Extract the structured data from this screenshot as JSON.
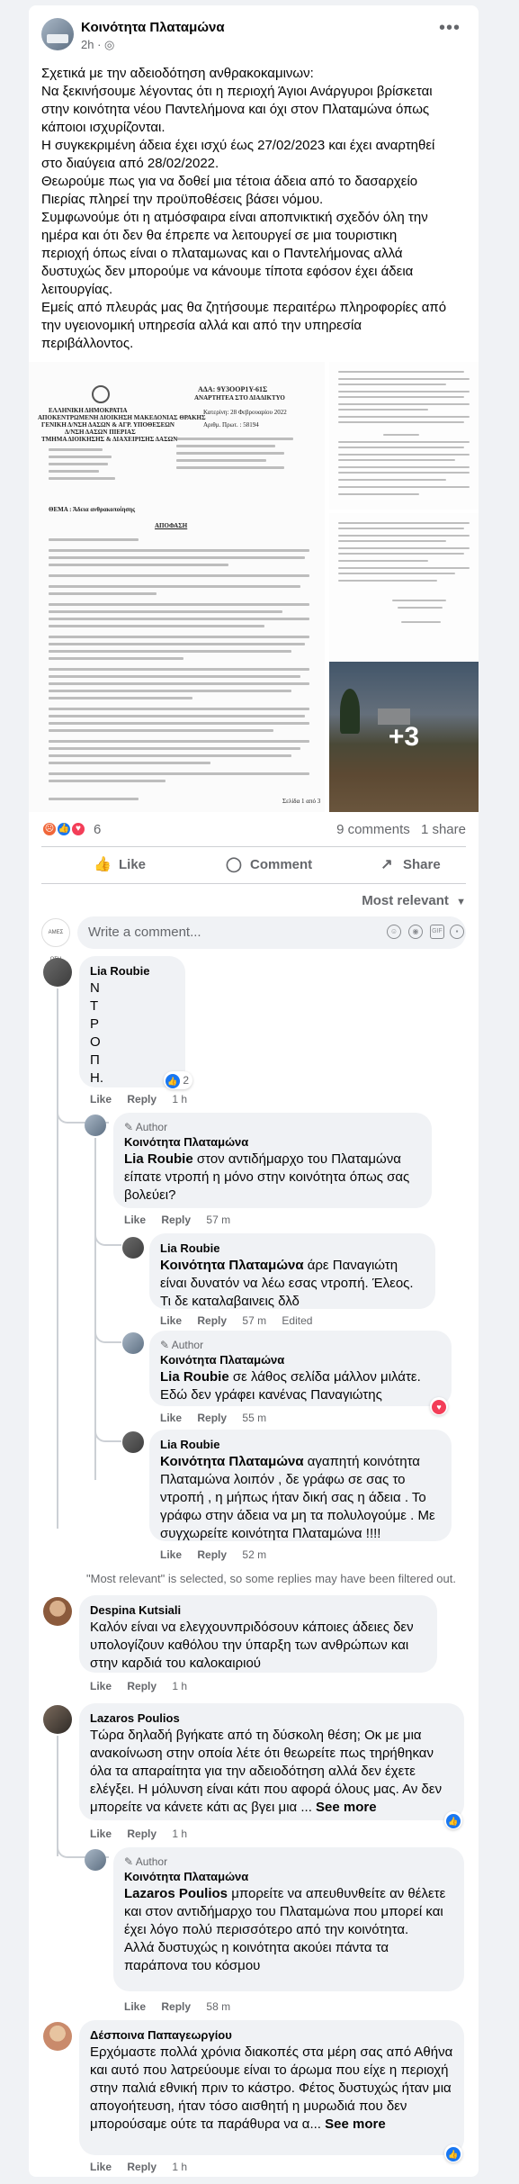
{
  "post": {
    "page_name": "Κοινότητα Πλαταμώνα",
    "time": "2h",
    "privacy_icon": "globe-icon",
    "text": [
      "Σχετικά με την αδειοδότηση ανθρακοκαμινων:",
      "Να ξεκινήσουμε λέγοντας ότι η περιοχή Άγιοι Ανάργυροι βρίσκεται",
      "στην κοινότητα νέου Παντελήμονα και όχι στον Πλαταμώνα όπως",
      "κάποιοι ισχυρίζονται.",
      "Η συγκεκριμένη άδεια έχει ισχύ έως 27/02/2023 και έχει αναρτηθεί",
      "στο διαύγεια από 28/02/2022.",
      "Θεωρούμε πως για να δοθεί μια τέτοια άδεια από το δασαρχείο",
      "Πιερίας πληρεί την προϋποθέσεις βάσει νόμου.",
      "Συμφωνούμε ότι η ατμόσφαιρα είναι αποπνικτική σχεδόν όλη την",
      "ημέρα και ότι δεν θα έπρεπε να λειτουργεί σε μια τουριστικη",
      "περιοχή όπως είναι ο πλαταμωνας και ο Παντελήμονας αλλά",
      "δυστυχώς δεν μπορούμε να κάνουμε τίποτα εφόσον έχει άδεια",
      "λειτουργίας.",
      "Εμείς από πλευράς μας θα ζητήσουμε περαιτέρω πληροφορίες από",
      "την υγειονομική υπηρεσία αλλά και από την υπηρεσία",
      "περιβάλλοντος."
    ],
    "more_count": "+3",
    "reaction_count": "6",
    "comments_count": "9 comments",
    "shares_count": "1 share"
  },
  "document": {
    "header_lines": [
      "ΕΛΛΗΝΙΚΗ ΔΗΜΟΚΡΑΤΙΑ",
      "ΑΠΟΚΕΝΤΡΩΜΕΝΗ ΔΙΟΙΚΗΣΗ ΜΑΚΕΔΟΝΙΑΣ ΘΡΑΚΗΣ",
      "ΓΕΝΙΚΗ Δ/ΝΣΗ ΔΑΣΩΝ & ΑΓΡ. ΥΠΟΘΕΣΕΩΝ",
      "Δ/ΝΣΗ ΔΑΣΩΝ ΠΙΕΡΙΑΣ",
      "ΤΜΗΜΑ ΔΙΟΙΚΗΣΗΣ & ΔΙΑΧΕΙΡΙΣΗΣ ΔΑΣΩΝ"
    ],
    "ada": "ΑΔΑ: 9Υ3ΟΟΡ1Υ-61Σ",
    "posted": "ΑΝΑΡΤΗΤΕΑ ΣΤΟ ΔΙΑΔΙΚΤΥΟ",
    "date": "Κατερίνη: 28 Φεβρουαρίου 2022",
    "protocol": "Αριθμ. Πρωτ. : 58194",
    "decision": "ΑΠΟΦΑΣΗ",
    "subject": "ΘΕΜΑ : Άδεια ανθρακοποίησης",
    "footer": "Σελίδα 1 από 3"
  },
  "actions": {
    "like": "Like",
    "comment": "Comment",
    "share": "Share"
  },
  "sort_label": "Most relevant",
  "composer": {
    "placeholder": "Write a comment...",
    "avatar_text": "ΑΜΕΣ ΟΣΗ"
  },
  "comments": [
    {
      "name": "Lia Roubie",
      "text_lines": [
        "Ν",
        "Τ",
        "Ρ",
        "Ο",
        "Π",
        "Η."
      ],
      "reaction_count": "2",
      "like": "Like",
      "reply": "Reply",
      "time": "1 h"
    },
    {
      "author_badge": "Author",
      "name": "Κοινότητα Πλαταμώνα",
      "mention": "Lia Roubie",
      "text": "στον αντιδήμαρχο του Πλαταμώνα είπατε ντροπή η μόνο στην κοινότητα όπως σας βολεύει?",
      "like": "Like",
      "reply": "Reply",
      "time": "57 m"
    },
    {
      "name": "Lia Roubie",
      "mention": "Κοινότητα Πλαταμώνα",
      "text": "άρε Παναγιώτη είναι δυνατόν να λέω εσας ντροπή. Έλεος. Τι δε καταλαβαινεις δλδ",
      "like": "Like",
      "reply": "Reply",
      "time": "57 m",
      "edited": "Edited"
    },
    {
      "author_badge": "Author",
      "name": "Κοινότητα Πλαταμώνα",
      "mention": "Lia Roubie",
      "text": "σε λάθος σελίδα μάλλον μιλάτε. Εδώ δεν γράφει κανένας Παναγιώτης",
      "like": "Like",
      "reply": "Reply",
      "time": "55 m"
    },
    {
      "name": "Lia Roubie",
      "mention": "Κοινότητα Πλαταμώνα",
      "text": "αγαπητή κοινότητα Πλαταμώνα λοιπόν , δε γράφω σε σας το ντροπή , η μήπως ήταν δική σας η άδεια . Το γράφω στην άδεια να μη τα πολυλογούμε . Με συγχωρείτε κοινότητα Πλαταμώνα !!!!",
      "like": "Like",
      "reply": "Reply",
      "time": "52 m"
    },
    {
      "name": "Despina Kutsiali",
      "text": "Καλόν είναι να ελεγχουνπριδόσουν κάποιες άδειες δεν υπολογίζουν καθόλου την ύπαρξη των ανθρώπων και στην καρδιά του καλοκαιριού",
      "like": "Like",
      "reply": "Reply",
      "time": "1 h"
    },
    {
      "name": "Lazaros Poulios",
      "text": "Τώρα δηλαδή βγήκατε από τη δύσκολη θέση; Οκ με μια ανακοίνωση στην οποία λέτε ότι θεωρείτε πως τηρήθηκαν όλα τα απαραίτητα για την αδειοδότηση αλλά δεν έχετε ελέγξει. Η μόλυνση είναι κάτι που αφορά όλους μας. Αν δεν μπορείτε να κάνετε κάτι ας βγει μια ...",
      "see_more": "See more",
      "like": "Like",
      "reply": "Reply",
      "time": "1 h"
    },
    {
      "author_badge": "Author",
      "name": "Κοινότητα Πλαταμώνα",
      "mention": "Lazaros Poulios",
      "text": "μπορείτε να απευθυνθείτε αν θέλετε και στον αντιδήμαρχο του Πλαταμώνα που μπορεί και έχει λόγο πολύ περισσότερο από την κοινότητα.",
      "text2": "Αλλά δυστυχώς η κοινότητα ακούει πάντα τα παράπονα του κόσμου",
      "like": "Like",
      "reply": "Reply",
      "time": "58 m"
    },
    {
      "name": "Δέσποινα Παπαγεωργίου",
      "text": "Ερχόμαστε πολλά χρόνια διακοπές στα μέρη σας από Αθήνα και αυτό που λατρεύουμε είναι το άρωμα που είχε η περιοχή στην παλιά εθνική πριν το κάστρο. Φέτος δυστυχώς ήταν μια απογοήτευση, ήταν τόσο αισθητή η μυρωδιά που δεν μπορούσαμε ούτε τα παράθυρα να α... ",
      "see_more": "See more",
      "like": "Like",
      "reply": "Reply",
      "time": "1 h"
    }
  ],
  "filter_note": "\"Most relevant\" is selected, so some replies may have been filtered out.",
  "colors": {
    "accent": "#1877f2",
    "muted": "#65676b",
    "bubble": "#f0f2f5",
    "angry": "#f0673a",
    "love": "#f33e58"
  }
}
